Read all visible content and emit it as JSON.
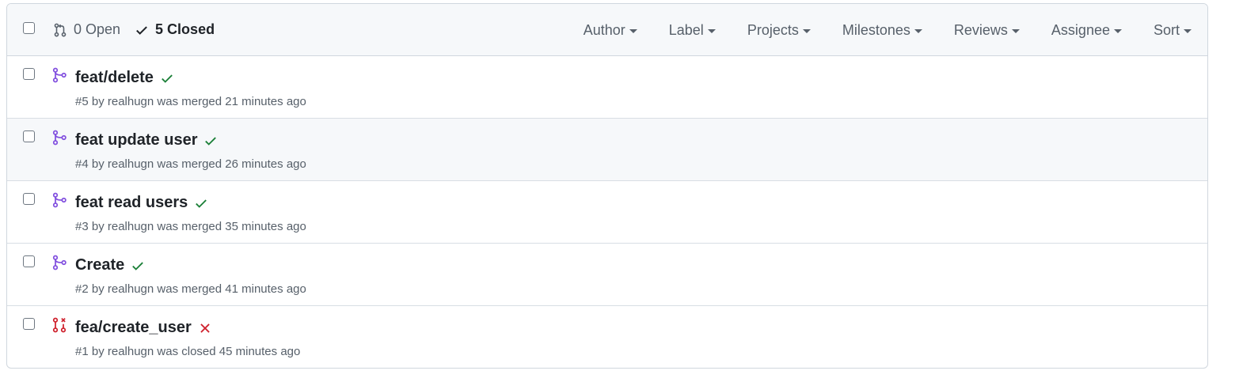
{
  "toolbar": {
    "open_label": "0 Open",
    "closed_label": "5 Closed",
    "filters": [
      "Author",
      "Label",
      "Projects",
      "Milestones",
      "Reviews",
      "Assignee",
      "Sort"
    ]
  },
  "pull_requests": [
    {
      "title": "feat/delete",
      "meta": "#5 by realhugn was merged 21 minutes ago",
      "state": "merged",
      "check": "success"
    },
    {
      "title": "feat update user",
      "meta": "#4 by realhugn was merged 26 minutes ago",
      "state": "merged",
      "check": "success"
    },
    {
      "title": "feat read users",
      "meta": "#3 by realhugn was merged 35 minutes ago",
      "state": "merged",
      "check": "success"
    },
    {
      "title": "Create",
      "meta": "#2 by realhugn was merged 41 minutes ago",
      "state": "merged",
      "check": "success"
    },
    {
      "title": "fea/create_user",
      "meta": "#1 by realhugn was closed 45 minutes ago",
      "state": "closed",
      "check": "failure"
    }
  ],
  "colors": {
    "merged": "#8250df",
    "closed": "#cf222e",
    "success": "#1a7f37",
    "failure": "#cf222e",
    "muted": "#57606a",
    "border": "#d0d7de"
  }
}
